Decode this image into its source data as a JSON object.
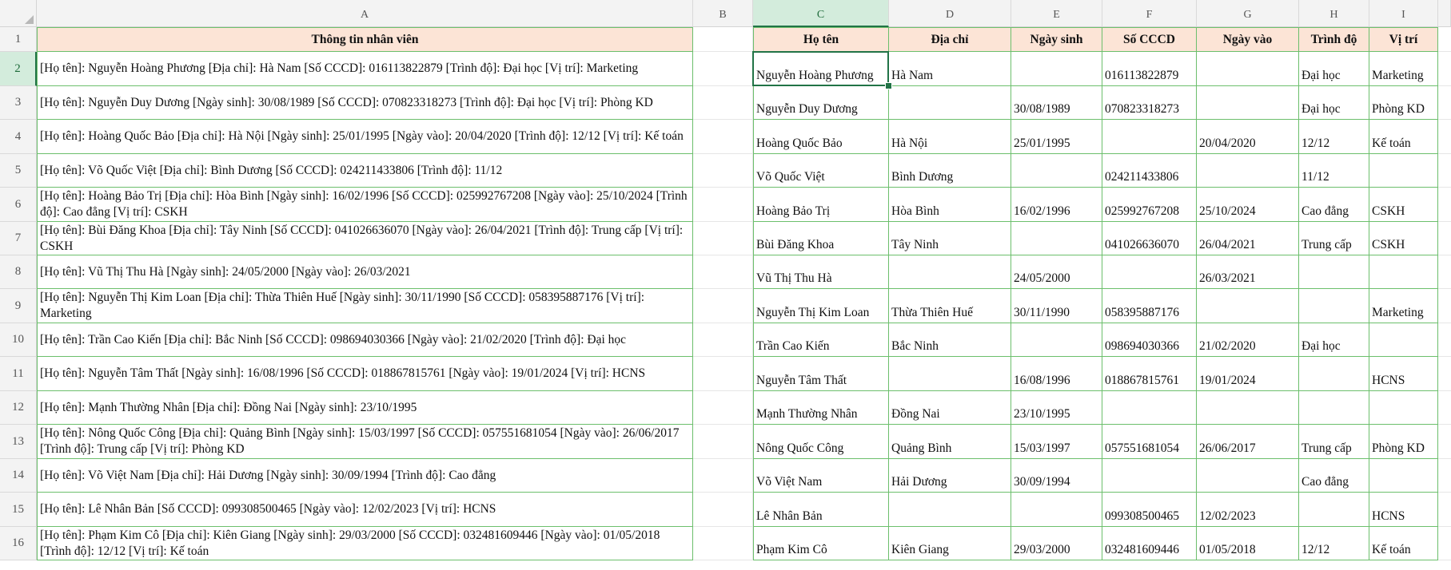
{
  "sheet": {
    "columns": [
      "A",
      "B",
      "C",
      "D",
      "E",
      "F",
      "G",
      "H",
      "I"
    ],
    "rows": [
      1,
      2,
      3,
      4,
      5,
      6,
      7,
      8,
      9,
      10,
      11,
      12,
      13,
      14,
      15,
      16
    ],
    "selected_cell": "C2",
    "colors": {
      "header_fill": "#fce4d6",
      "table_border": "#6cbf6c",
      "selection": "#217346"
    }
  },
  "source": {
    "header": "Thông tin nhân viên",
    "rows": [
      "[Họ tên]: Nguyễn Hoàng Phương [Địa chỉ]: Hà Nam [Số CCCD]: 016113822879 [Trình độ]: Đại học [Vị trí]: Marketing",
      "[Họ tên]: Nguyễn Duy Dương [Ngày sinh]: 30/08/1989 [Số CCCD]: 070823318273 [Trình độ]: Đại học [Vị trí]: Phòng KD",
      "[Họ tên]: Hoàng Quốc Bảo [Địa chỉ]: Hà Nội [Ngày sinh]: 25/01/1995 [Ngày vào]: 20/04/2020 [Trình độ]: 12/12 [Vị trí]: Kế toán",
      "[Họ tên]: Võ Quốc Việt [Địa chỉ]: Bình Dương [Số CCCD]: 024211433806 [Trình độ]: 11/12",
      "[Họ tên]: Hoàng Bảo Trị [Địa chỉ]: Hòa Bình [Ngày sinh]: 16/02/1996 [Số CCCD]: 025992767208 [Ngày vào]: 25/10/2024 [Trình độ]: Cao đẳng [Vị trí]: CSKH",
      "[Họ tên]: Bùi Đăng Khoa [Địa chỉ]: Tây Ninh [Số CCCD]: 041026636070 [Ngày vào]: 26/04/2021 [Trình độ]: Trung cấp [Vị trí]: CSKH",
      "[Họ tên]: Vũ Thị Thu Hà [Ngày sinh]: 24/05/2000 [Ngày vào]: 26/03/2021",
      "[Họ tên]: Nguyễn Thị Kim Loan [Địa chỉ]: Thừa Thiên Huế [Ngày sinh]: 30/11/1990 [Số CCCD]: 058395887176 [Vị trí]: Marketing",
      "[Họ tên]: Trần Cao Kiến [Địa chỉ]: Bắc Ninh [Số CCCD]: 098694030366 [Ngày vào]: 21/02/2020 [Trình độ]: Đại học",
      "[Họ tên]: Nguyễn Tâm Thất [Ngày sinh]: 16/08/1996 [Số CCCD]: 018867815761 [Ngày vào]: 19/01/2024 [Vị trí]: HCNS",
      "[Họ tên]: Mạnh Thường Nhân [Địa chỉ]: Đồng Nai [Ngày sinh]: 23/10/1995",
      "[Họ tên]: Nông Quốc Công [Địa chỉ]: Quảng Bình [Ngày sinh]: 15/03/1997 [Số CCCD]: 057551681054 [Ngày vào]: 26/06/2017 [Trình độ]: Trung cấp [Vị trí]: Phòng KD",
      "[Họ tên]: Võ Việt Nam [Địa chỉ]: Hải Dương [Ngày sinh]: 30/09/1994 [Trình độ]: Cao đẳng",
      "[Họ tên]: Lê Nhân Bản [Số CCCD]: 099308500465 [Ngày vào]: 12/02/2023 [Vị trí]: HCNS",
      "[Họ tên]: Phạm Kim Cô [Địa chỉ]: Kiên Giang [Ngày sinh]: 29/03/2000 [Số CCCD]: 032481609446 [Ngày vào]: 01/05/2018 [Trình độ]: 12/12 [Vị trí]: Kế toán"
    ]
  },
  "table": {
    "headers": [
      "Họ tên",
      "Địa chỉ",
      "Ngày sinh",
      "Số CCCD",
      "Ngày vào",
      "Trình độ",
      "Vị trí"
    ],
    "rows": [
      [
        "Nguyễn Hoàng Phương",
        "Hà Nam",
        "",
        "016113822879",
        "",
        "Đại học",
        "Marketing"
      ],
      [
        "Nguyễn Duy Dương",
        "",
        "30/08/1989",
        "070823318273",
        "",
        "Đại học",
        "Phòng KD"
      ],
      [
        "Hoàng Quốc Bảo",
        "Hà Nội",
        "25/01/1995",
        "",
        "20/04/2020",
        "12/12",
        "Kế toán"
      ],
      [
        "Võ Quốc Việt",
        "Bình Dương",
        "",
        "024211433806",
        "",
        "11/12",
        ""
      ],
      [
        "Hoàng Bảo Trị",
        "Hòa Bình",
        "16/02/1996",
        "025992767208",
        "25/10/2024",
        "Cao đẳng",
        "CSKH"
      ],
      [
        "Bùi Đăng Khoa",
        "Tây Ninh",
        "",
        "041026636070",
        "26/04/2021",
        "Trung cấp",
        "CSKH"
      ],
      [
        "Vũ Thị Thu Hà",
        "",
        "24/05/2000",
        "",
        "26/03/2021",
        "",
        ""
      ],
      [
        "Nguyễn Thị Kim Loan",
        "Thừa Thiên Huế",
        "30/11/1990",
        "058395887176",
        "",
        "",
        "Marketing"
      ],
      [
        "Trần Cao Kiến",
        "Bắc Ninh",
        "",
        "098694030366",
        "21/02/2020",
        "Đại học",
        ""
      ],
      [
        "Nguyễn Tâm Thất",
        "",
        "16/08/1996",
        "018867815761",
        "19/01/2024",
        "",
        "HCNS"
      ],
      [
        "Mạnh Thường Nhân",
        "Đồng Nai",
        "23/10/1995",
        "",
        "",
        "",
        ""
      ],
      [
        "Nông Quốc Công",
        "Quảng Bình",
        "15/03/1997",
        "057551681054",
        "26/06/2017",
        "Trung cấp",
        "Phòng KD"
      ],
      [
        "Võ Việt Nam",
        "Hải Dương",
        "30/09/1994",
        "",
        "",
        "Cao đẳng",
        ""
      ],
      [
        "Lê Nhân Bản",
        "",
        "",
        "099308500465",
        "12/02/2023",
        "",
        "HCNS"
      ],
      [
        "Phạm Kim Cô",
        "Kiên Giang",
        "29/03/2000",
        "032481609446",
        "01/05/2018",
        "12/12",
        "Kế toán"
      ]
    ]
  }
}
